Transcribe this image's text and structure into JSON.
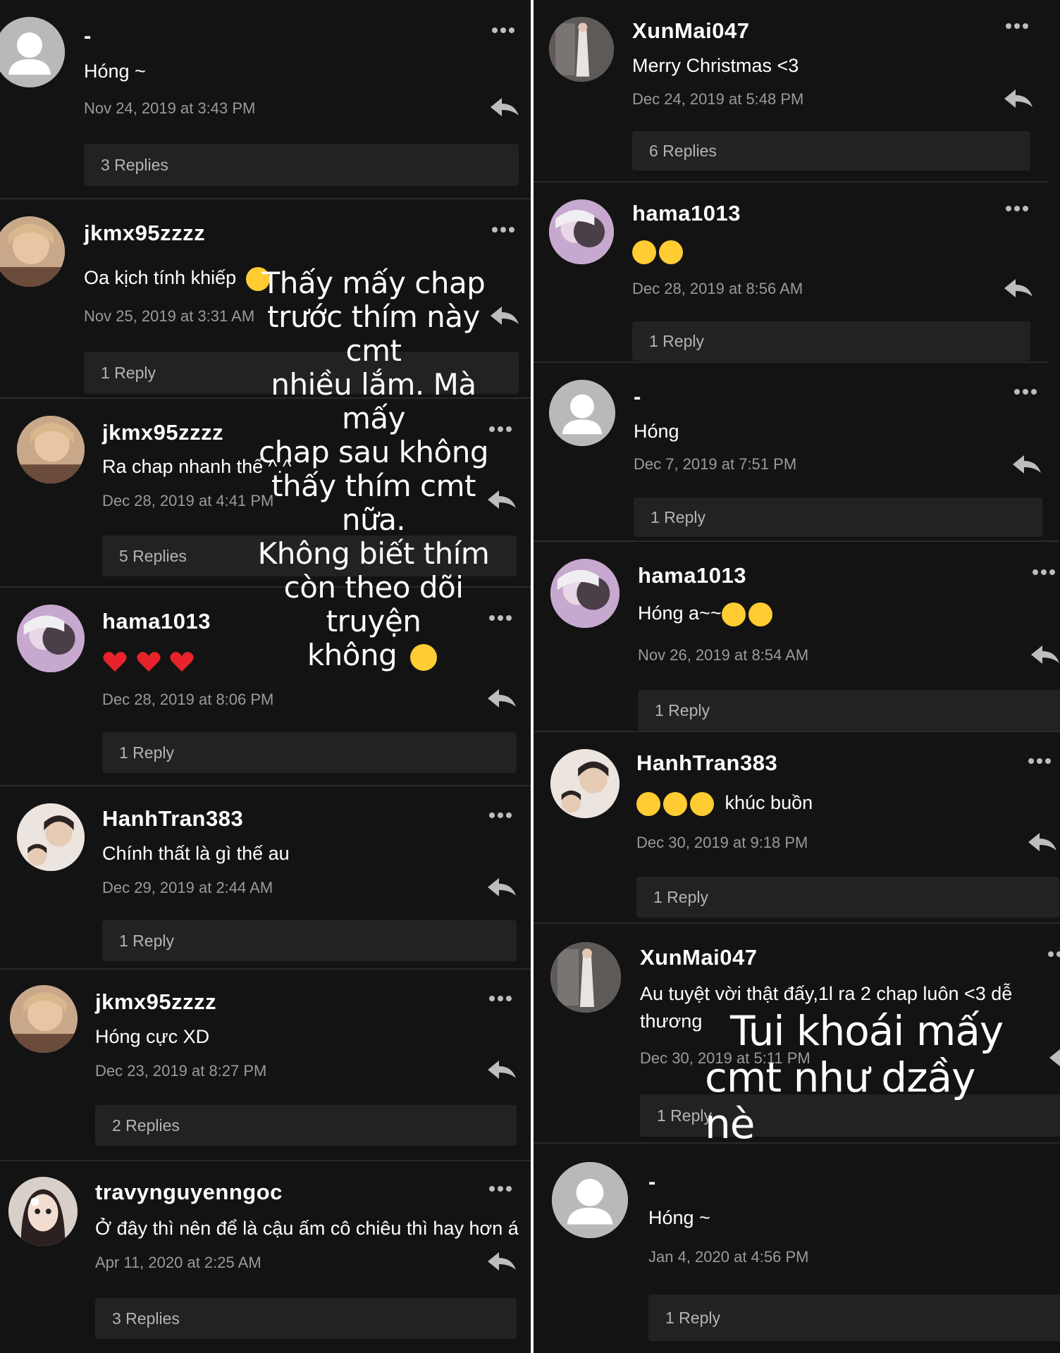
{
  "left": [
    {
      "username": "-",
      "text": "Hóng ~",
      "date": "Nov 24, 2019 at 3:43 PM",
      "replies": "3 Replies"
    },
    {
      "username": "jkmx95zzzz",
      "text": "Oa kịch tính khiếp",
      "date": "Nov 25, 2019 at 3:31 AM",
      "replies": "1 Reply"
    },
    {
      "username": "jkmx95zzzz",
      "text": "Ra chap nhanh thế ^.^",
      "date": "Dec 28, 2019 at 4:41 PM",
      "replies": "5 Replies"
    },
    {
      "username": "hama1013",
      "text": "",
      "date": "Dec 28, 2019 at 8:06 PM",
      "replies": "1 Reply"
    },
    {
      "username": "HanhTran383",
      "text": "Chính thất là gì thế au",
      "date": "Dec 29, 2019 at 2:44 AM",
      "replies": "1 Reply"
    },
    {
      "username": "jkmx95zzzz",
      "text": "Hóng cực XD",
      "date": "Dec 23, 2019 at 8:27 PM",
      "replies": "2 Replies"
    },
    {
      "username": "travynguyenngoc",
      "text": "Ở đây thì nên để là cậu ấm cô chiêu thì hay hơn á",
      "date": "Apr 11, 2020 at 2:25 AM",
      "replies": "3 Replies"
    }
  ],
  "right": [
    {
      "username": "XunMai047",
      "text": "Merry Christmas <3",
      "date": "Dec 24, 2019 at 5:48 PM",
      "replies": "6 Replies"
    },
    {
      "username": "hama1013",
      "text": "",
      "date": "Dec 28, 2019 at 8:56 AM",
      "replies": "1 Reply"
    },
    {
      "username": "-",
      "text": "Hóng",
      "date": "Dec 7, 2019 at 7:51 PM",
      "replies": "1 Reply"
    },
    {
      "username": "hama1013",
      "text": "Hóng a~~",
      "date": "Nov 26, 2019 at 8:54 AM",
      "replies": "1 Reply"
    },
    {
      "username": "HanhTran383",
      "text": "khúc buồn",
      "date": "Dec 30, 2019 at 9:18 PM",
      "replies": "1 Reply"
    },
    {
      "username": "XunMai047",
      "text": "Au tuyệt vời thật đấy,1l ra 2 chap luôn <3 dễ thương",
      "date": "Dec 30, 2019 at 5:11 PM",
      "replies": "1 Reply"
    },
    {
      "username": "-",
      "text": "Hóng ~",
      "date": "Jan 4, 2020 at 4:56 PM",
      "replies": "1 Reply"
    }
  ],
  "overlay_left": {
    "line1": "Thấy mấy chap",
    "line2": "trước thím này cmt",
    "line3": "nhiều lắm. Mà mấy",
    "line4": "chap sau không",
    "line5": "thấy thím cmt nữa.",
    "line6": "Không biết thím",
    "line7": "còn theo dõi truyện",
    "line8": "không"
  },
  "overlay_right": {
    "line1": "Tui khoái mấy",
    "line2": "cmt như dzầy nè"
  },
  "colors": {
    "background": "#131313",
    "text": "#ffffff",
    "muted": "#9a9a9a",
    "reply_box": "#222222",
    "emoji": "#ffcc33",
    "heart": "#e8232b"
  },
  "icons": [
    "more-options-icon",
    "reply-arrow-icon",
    "default-avatar-icon",
    "emoji-icon",
    "heart-icon"
  ]
}
